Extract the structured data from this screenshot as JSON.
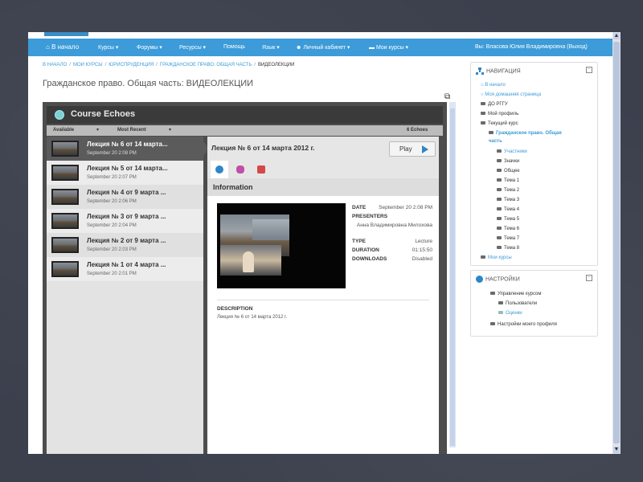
{
  "navbar": {
    "home": "В начало",
    "items": [
      "Курсы ▾",
      "Форумы ▾",
      "Ресурсы ▾",
      "Помощь",
      "Язык ▾",
      "Личный кабинет ▾",
      "Мои курсы ▾"
    ],
    "user": "Вы: Власова Юлия Владимировна (Выход)"
  },
  "breadcrumb": {
    "items": [
      "В НАЧАЛО",
      "МОИ КУРСЫ",
      "ЮРИСПРУДЕНЦИЯ",
      "ГРАЖДАНСКОЕ ПРАВО. ОБЩАЯ ЧАСТЬ"
    ],
    "current": "ВИДЕОЛЕКЦИИ"
  },
  "page_title": "Гражданское право. Общая часть: ВИДЕОЛЕКЦИИ",
  "echoes": {
    "title": "Course Echoes",
    "filter_available": "Available",
    "filter_recent": "Most Recent",
    "count": "6 Echoes",
    "items": [
      {
        "title": "Лекция № 6 от 14 марта...",
        "date": "September 20 2:08 PM"
      },
      {
        "title": "Лекция № 5 от 14 марта...",
        "date": "September 20 2:07 PM"
      },
      {
        "title": "Лекция № 4 от 9 марта ...",
        "date": "September 20 2:06 PM"
      },
      {
        "title": "Лекция № 3 от 9 марта ...",
        "date": "September 20 2:04 PM"
      },
      {
        "title": "Лекция № 2 от 9 марта ...",
        "date": "September 20 2:03 PM"
      },
      {
        "title": "Лекция № 1 от 4 марта ...",
        "date": "September 20 2:01 PM"
      }
    ],
    "detail": {
      "title": "Лекция № 6 от 14 марта 2012 г.",
      "play": "Play",
      "section": "Information",
      "meta": {
        "date_k": "DATE",
        "date_v": "September 20 2:08 PM",
        "presenters_k": "PRESENTERS",
        "presenters_v": "Анна Владимировна Милохова",
        "type_k": "TYPE",
        "type_v": "Lecture",
        "duration_k": "DURATION",
        "duration_v": "01:15:50",
        "downloads_k": "DOWNLOADS",
        "downloads_v": "Disabled"
      },
      "description_k": "DESCRIPTION",
      "description_v": "Лекция № 6 от 14 марта 2012 г."
    }
  },
  "navigation": {
    "title": "НАВИГАЦИЯ",
    "items": {
      "home": "В начало",
      "my_home": "Моя домашняя страница",
      "do_rggu": "ДО РГГУ",
      "profile": "Мой профиль",
      "current_course": "Текущий курс",
      "course_name_1": "Гражданское право. Общая",
      "course_name_2": "часть",
      "participants": "Участники",
      "badges": "Значки",
      "general": "Общее",
      "topics": [
        "Тема 1",
        "Тема 2",
        "Тема 3",
        "Тема 4",
        "Тема 5",
        "Тема 6",
        "Тема 7",
        "Тема 8"
      ],
      "my_courses": "Мои курсы"
    }
  },
  "settings": {
    "title": "НАСТРОЙКИ",
    "course_admin": "Управление курсом",
    "users": "Пользователи",
    "grades": "Оценки",
    "profile_settings": "Настройки моего профиля"
  },
  "colors": {
    "navbar": "#3c9bd8",
    "link": "#3c9bd8",
    "play_icon": "#2e86c8"
  }
}
